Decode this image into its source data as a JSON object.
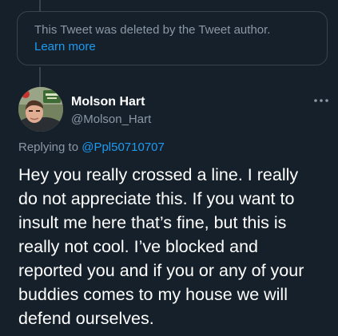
{
  "deleted_notice": {
    "text": "This Tweet was deleted by the Tweet author.",
    "link": "Learn more"
  },
  "author": {
    "name": "Molson Hart",
    "handle": "@Molson_Hart"
  },
  "more_icon": "more-horizontal-icon",
  "reply": {
    "prefix": "Replying to ",
    "mention": "@Ppl50710707"
  },
  "tweet": {
    "lines": [
      "Hey you really crossed a line. I really",
      "do not appreciate this. If you want to",
      "insult me here that’s fine, but this is",
      "really not cool. I’ve blocked and",
      "reported you and if you or any of your",
      "buddies comes to my house we will",
      "defend ourselves."
    ]
  },
  "colors": {
    "background": "#15202b",
    "border": "#38444d",
    "secondary_text": "#8b98a5",
    "link": "#1d9bf0",
    "primary_text": "#ffffff"
  }
}
